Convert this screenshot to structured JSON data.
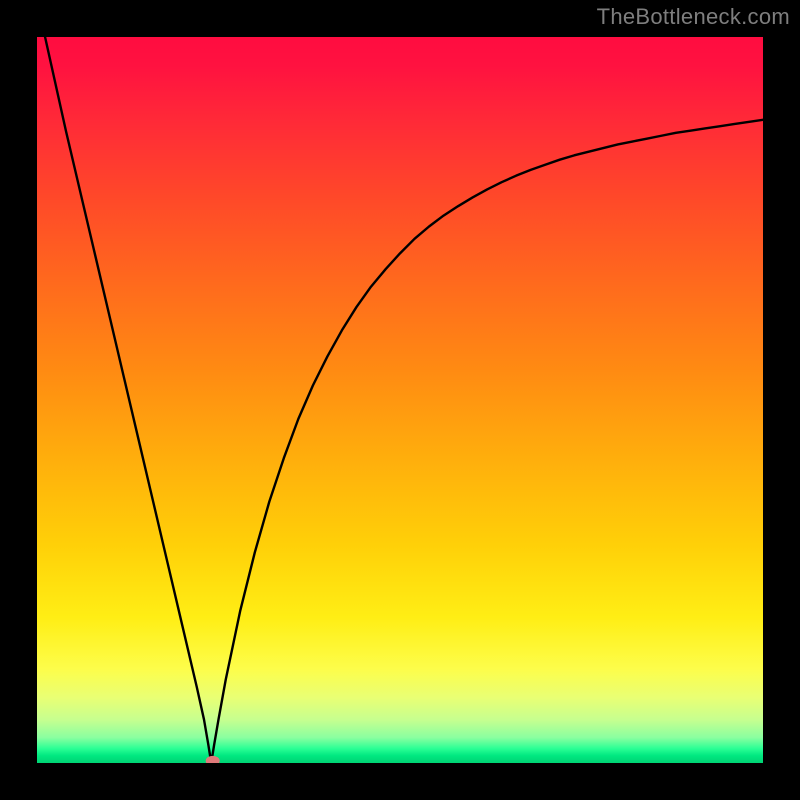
{
  "watermark": "TheBottleneck.com",
  "chart_data": {
    "type": "line",
    "title": "",
    "xlabel": "",
    "ylabel": "",
    "xlim": [
      0,
      100
    ],
    "ylim": [
      0,
      100
    ],
    "grid": false,
    "legend": false,
    "notch_x": 24,
    "marker": {
      "x": 24.2,
      "y": 0.3,
      "color": "#e07a7a"
    },
    "series": [
      {
        "name": "curve",
        "color": "#000000",
        "x": [
          0,
          2,
          4,
          6,
          8,
          10,
          12,
          14,
          16,
          18,
          20,
          22,
          23,
          23.6,
          24,
          24.4,
          25,
          26,
          28,
          30,
          32,
          34,
          36,
          38,
          40,
          42,
          44,
          46,
          48,
          50,
          52,
          54,
          56,
          58,
          60,
          62,
          64,
          66,
          68,
          70,
          72,
          74,
          76,
          78,
          80,
          82,
          84,
          86,
          88,
          90,
          92,
          94,
          96,
          98,
          100
        ],
        "y": [
          105,
          96,
          87,
          78.5,
          70,
          61.5,
          53,
          44.5,
          36,
          27.5,
          19,
          10.5,
          6,
          2.5,
          0,
          2.5,
          6,
          11.5,
          21,
          29,
          36,
          42,
          47.4,
          52,
          56,
          59.6,
          62.8,
          65.6,
          68,
          70.2,
          72.2,
          73.9,
          75.4,
          76.7,
          77.9,
          79,
          80,
          80.9,
          81.7,
          82.4,
          83.1,
          83.7,
          84.2,
          84.7,
          85.2,
          85.6,
          86,
          86.4,
          86.8,
          87.1,
          87.4,
          87.7,
          88,
          88.3,
          88.6
        ]
      }
    ]
  }
}
